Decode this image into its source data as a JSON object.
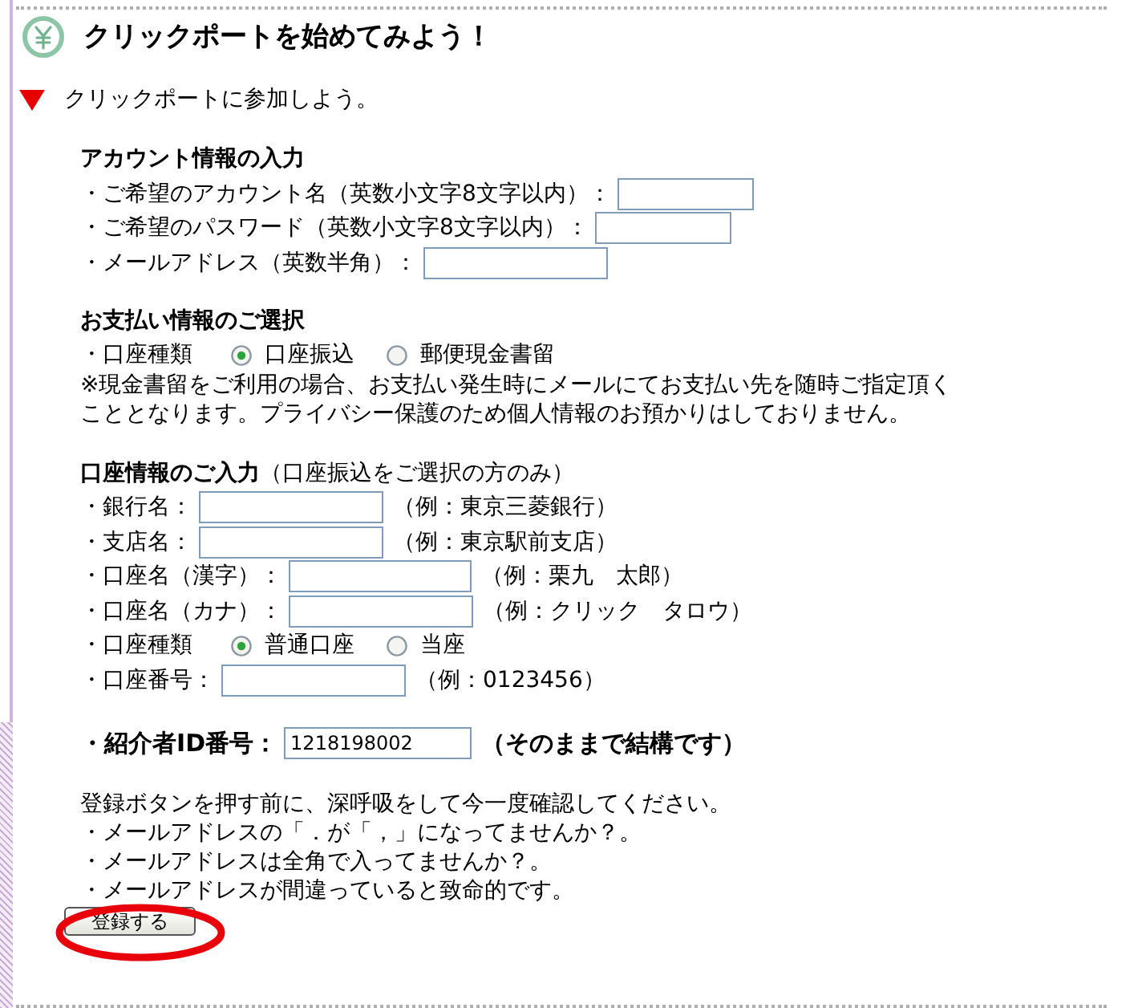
{
  "header": {
    "title": "クリックポートを始めてみよう！"
  },
  "intro": {
    "text": "クリックポートに参加しよう。"
  },
  "account_section": {
    "heading": "アカウント情報の入力",
    "fields": [
      {
        "label": "・ご希望のアカウント名（英数小文字8文字以内）："
      },
      {
        "label": "・ご希望のパスワード（英数小文字8文字以内）："
      },
      {
        "label": "・メールアドレス（英数半角）："
      }
    ]
  },
  "payment_section": {
    "heading": "お支払い情報のご選択",
    "choice": {
      "label": "・口座種類",
      "options": [
        {
          "label": "口座振込",
          "selected": true
        },
        {
          "label": "郵便現金書留",
          "selected": false
        }
      ]
    },
    "note": "※現金書留をご利用の場合、お支払い発生時にメールにてお支払い先を随時ご指定頂くこととなります。プライバシー保護のため個人情報のお預かりはしておりません。"
  },
  "bank_section": {
    "heading": "**口座情報のご入力**（口座振込をご選択の方のみ）",
    "rows": [
      {
        "kind": "field",
        "label": "・銀行名：",
        "example": "（例：東京三菱銀行）"
      },
      {
        "kind": "field",
        "label": "・支店名：",
        "example": "（例：東京駅前支店）"
      },
      {
        "kind": "field",
        "label": "・口座名（漢字）：",
        "example": "（例：栗九　太郎）"
      },
      {
        "kind": "field",
        "label": "・口座名（カナ）：",
        "example": "（例：クリック　タロウ）"
      },
      {
        "kind": "choice",
        "label": "・口座種類",
        "options": [
          {
            "label": "普通口座",
            "selected": true
          },
          {
            "label": "当座",
            "selected": false
          }
        ]
      },
      {
        "kind": "field",
        "label": "・口座番号：",
        "example": "（例：0123456）"
      }
    ]
  },
  "referral": {
    "label": "・紹介者ID番号：",
    "value": "1218198002",
    "note": "（そのままで結構です）"
  },
  "confirm": {
    "intro": "登録ボタンを押す前に、深呼吸をして今一度確認してください。",
    "items": [
      "・メールアドレスの「．が「，」になってませんか？。",
      "・メールアドレスは全角で入ってませんか？。",
      "・メールアドレスが間違っていると致命的です。"
    ]
  },
  "submit_button": {
    "label": "登録する",
    "circled": true
  }
}
